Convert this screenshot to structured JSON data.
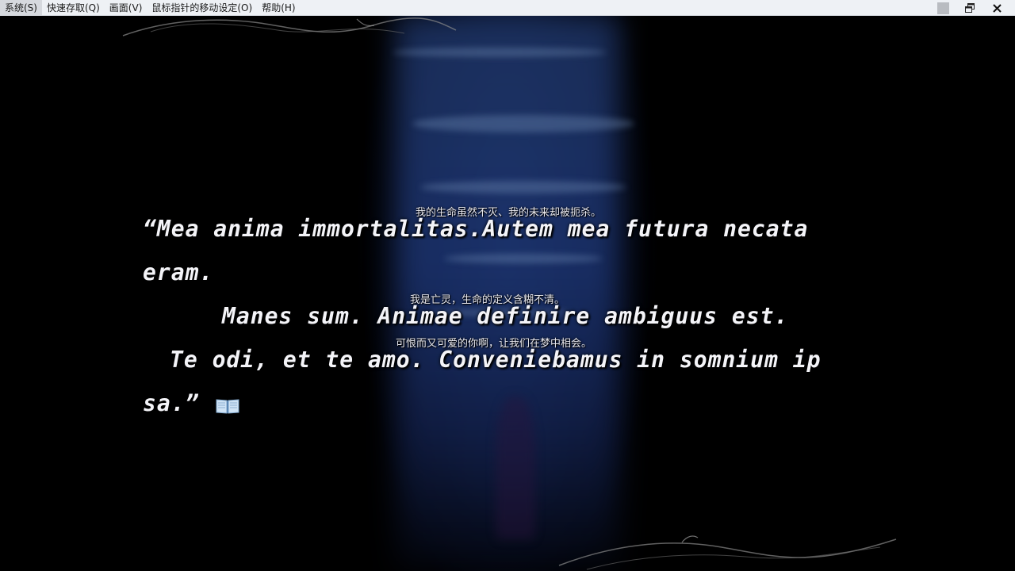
{
  "menu": {
    "items": [
      "系统(S)",
      "快速存取(Q)",
      "画面(V)",
      "鼠标指针的移动设定(O)",
      "帮助(H)"
    ]
  },
  "window_controls": [
    "minimize-icon",
    "restore-icon",
    "close-icon"
  ],
  "dialogue": {
    "sub1": "我的生命虽然不灭、我的未来却被扼杀。",
    "line1": "“Mea anima immortalitas.Autem mea futura necata",
    "line2": "eram.",
    "sub2": "我是亡灵，生命的定义含糊不清。",
    "line3": "Manes sum. Animae definire ambiguus est.",
    "sub3": "可恨而又可爱的你啊，让我们在梦中相会。",
    "line4": "Te odi, et te amo. Conveniebamus in somnium ip",
    "line5": "sa.”"
  },
  "icons": [
    "book-icon"
  ]
}
